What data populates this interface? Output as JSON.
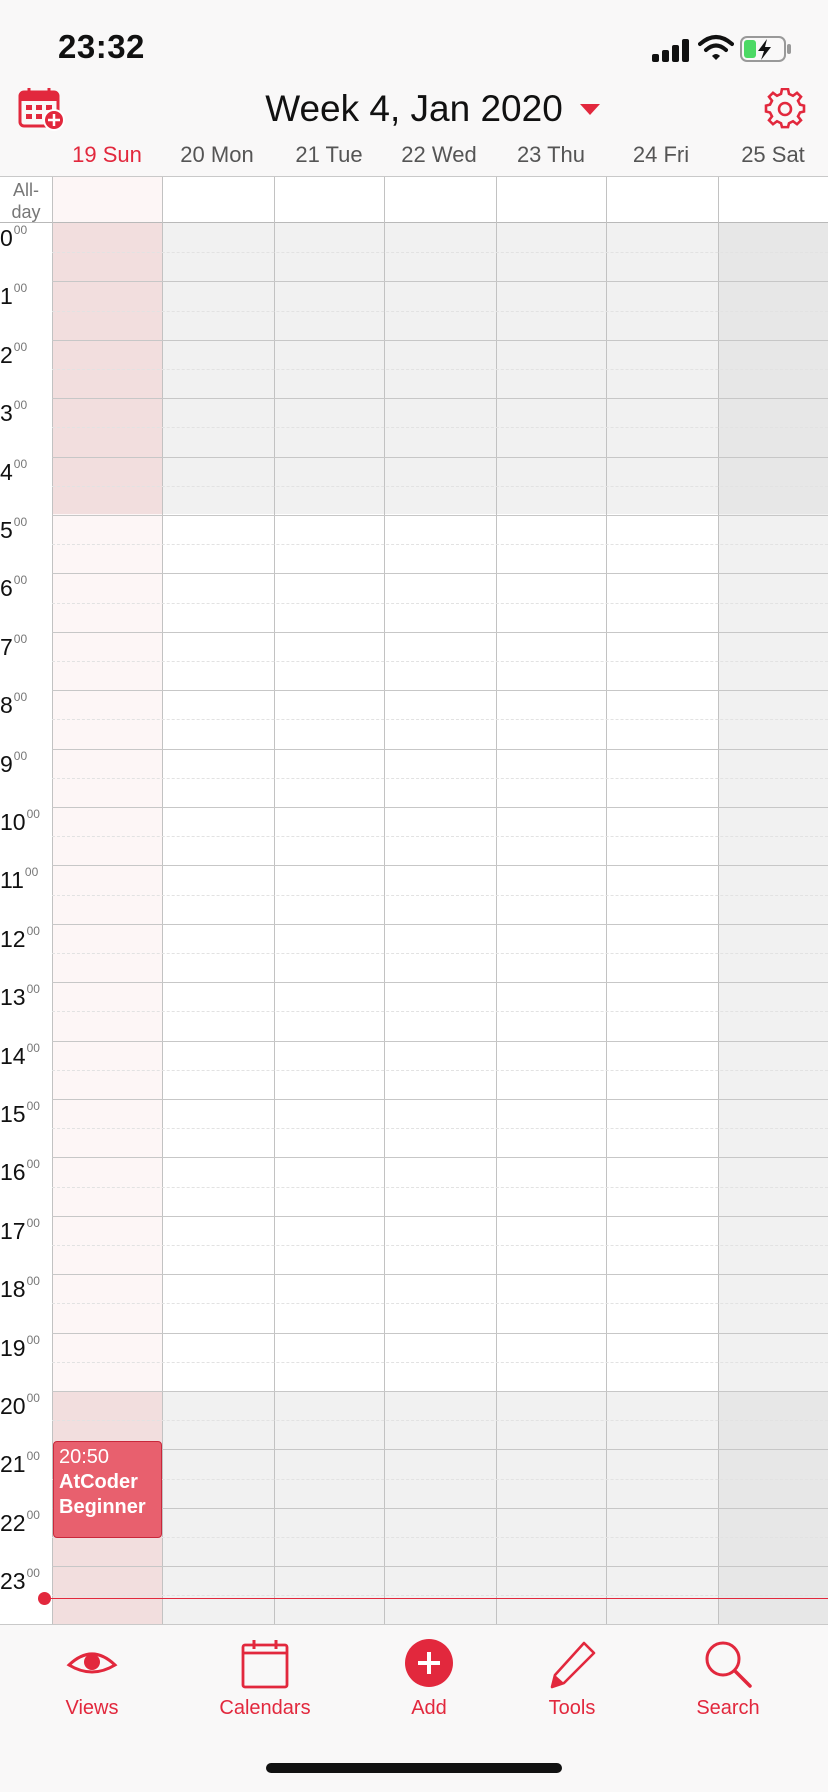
{
  "status_bar": {
    "time": "23:32",
    "battery": "charging"
  },
  "header": {
    "title": "Week 4, Jan 2020",
    "days": [
      {
        "label": "19 Sun",
        "today": true
      },
      {
        "label": "20 Mon",
        "today": false
      },
      {
        "label": "21 Tue",
        "today": false
      },
      {
        "label": "22 Wed",
        "today": false
      },
      {
        "label": "23 Thu",
        "today": false
      },
      {
        "label": "24 Fri",
        "today": false
      },
      {
        "label": "25 Sat",
        "today": false
      }
    ]
  },
  "grid": {
    "allday_label": "All-day",
    "hours": [
      "0",
      "1",
      "2",
      "3",
      "4",
      "5",
      "6",
      "7",
      "8",
      "9",
      "10",
      "11",
      "12",
      "13",
      "14",
      "15",
      "16",
      "17",
      "18",
      "19",
      "20",
      "21",
      "22",
      "23"
    ],
    "minute_suffix": "00",
    "now_time": "23:32"
  },
  "event": {
    "time": "20:50",
    "title": "AtCoder Beginner",
    "color": "#e8606e"
  },
  "tabbar": {
    "views": "Views",
    "calendars": "Calendars",
    "add": "Add",
    "tools": "Tools",
    "search": "Search"
  },
  "colors": {
    "accent": "#e2283d",
    "today_column": "#fdf6f6",
    "off_hours": "#f1f1f1"
  }
}
